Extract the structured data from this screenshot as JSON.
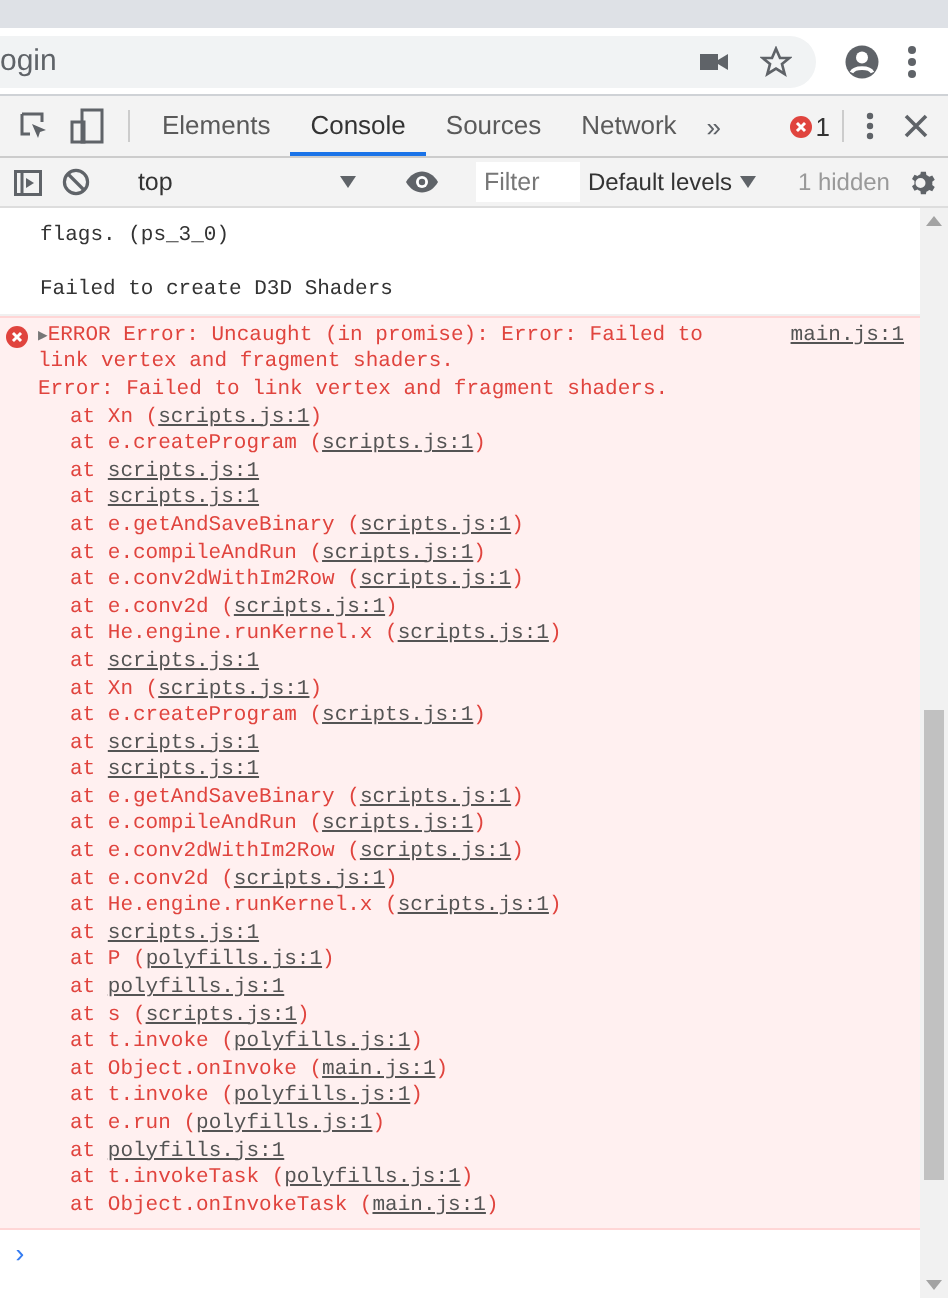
{
  "browser": {
    "address": "ogin"
  },
  "devtools": {
    "tabs": [
      {
        "label": "Elements",
        "selected": false
      },
      {
        "label": "Console",
        "selected": true
      },
      {
        "label": "Sources",
        "selected": false
      },
      {
        "label": "Network",
        "selected": false
      }
    ],
    "more": "»",
    "error_count": "1"
  },
  "toolbar": {
    "context": "top",
    "filter_placeholder": "Filter",
    "levels": "Default levels",
    "hidden": "1 hidden"
  },
  "console": {
    "messages": [
      {
        "kind": "log",
        "lines": [
          "flags. (ps_3_0)",
          "Failed to create D3D Shaders"
        ]
      },
      {
        "kind": "error",
        "expander": "▶",
        "lines": [
          "ERROR Error: Uncaught (in promise): Error: Failed to",
          "link vertex and fragment shaders.",
          "Error: Failed to link vertex and fragment shaders."
        ],
        "source": "main.js:1",
        "stack": [
          {
            "prefix": "at Xn (",
            "link": "scripts.js:1",
            "suffix": ")"
          },
          {
            "prefix": "at e.createProgram (",
            "link": "scripts.js:1",
            "suffix": ")"
          },
          {
            "prefix": "at ",
            "link": "scripts.js:1"
          },
          {
            "prefix": "at ",
            "link": "scripts.js:1"
          },
          {
            "prefix": "at e.getAndSaveBinary (",
            "link": "scripts.js:1",
            "suffix": ")"
          },
          {
            "prefix": "at e.compileAndRun (",
            "link": "scripts.js:1",
            "suffix": ")"
          },
          {
            "prefix": "at e.conv2dWithIm2Row (",
            "link": "scripts.js:1",
            "suffix": ")"
          },
          {
            "prefix": "at e.conv2d (",
            "link": "scripts.js:1",
            "suffix": ")"
          },
          {
            "prefix": "at He.engine.runKernel.x (",
            "link": "scripts.js:1",
            "suffix": ")"
          },
          {
            "prefix": "at ",
            "link": "scripts.js:1"
          },
          {
            "prefix": "at Xn (",
            "link": "scripts.js:1",
            "suffix": ")"
          },
          {
            "prefix": "at e.createProgram (",
            "link": "scripts.js:1",
            "suffix": ")"
          },
          {
            "prefix": "at ",
            "link": "scripts.js:1"
          },
          {
            "prefix": "at ",
            "link": "scripts.js:1"
          },
          {
            "prefix": "at e.getAndSaveBinary (",
            "link": "scripts.js:1",
            "suffix": ")"
          },
          {
            "prefix": "at e.compileAndRun (",
            "link": "scripts.js:1",
            "suffix": ")"
          },
          {
            "prefix": "at e.conv2dWithIm2Row (",
            "link": "scripts.js:1",
            "suffix": ")"
          },
          {
            "prefix": "at e.conv2d (",
            "link": "scripts.js:1",
            "suffix": ")"
          },
          {
            "prefix": "at He.engine.runKernel.x (",
            "link": "scripts.js:1",
            "suffix": ")"
          },
          {
            "prefix": "at ",
            "link": "scripts.js:1"
          },
          {
            "prefix": "at P (",
            "link": "polyfills.js:1",
            "suffix": ")"
          },
          {
            "prefix": "at ",
            "link": "polyfills.js:1"
          },
          {
            "prefix": "at s (",
            "link": "scripts.js:1",
            "suffix": ")"
          },
          {
            "prefix": "at t.invoke (",
            "link": "polyfills.js:1",
            "suffix": ")"
          },
          {
            "prefix": "at Object.onInvoke (",
            "link": "main.js:1",
            "suffix": ")"
          },
          {
            "prefix": "at t.invoke (",
            "link": "polyfills.js:1",
            "suffix": ")"
          },
          {
            "prefix": "at e.run (",
            "link": "polyfills.js:1",
            "suffix": ")"
          },
          {
            "prefix": "at ",
            "link": "polyfills.js:1"
          },
          {
            "prefix": "at t.invokeTask (",
            "link": "polyfills.js:1",
            "suffix": ")"
          },
          {
            "prefix": "at Object.onInvokeTask (",
            "link": "main.js:1",
            "suffix": ")"
          }
        ]
      }
    ],
    "prompt": "›"
  }
}
